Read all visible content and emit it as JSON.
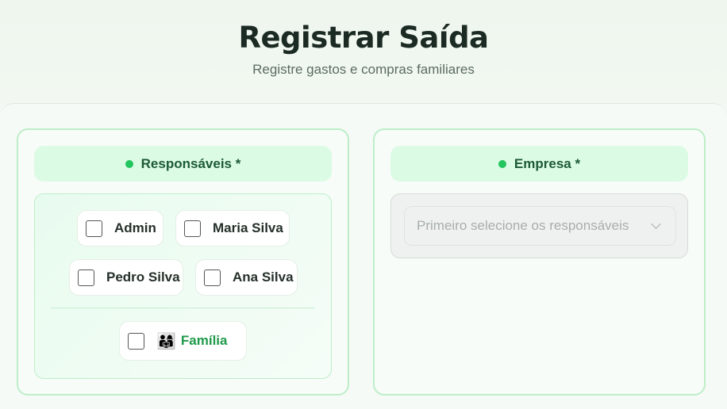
{
  "header": {
    "title": "Registrar Saída",
    "subtitle": "Registre gastos e compras familiares"
  },
  "responsaveis": {
    "label": "Responsáveis *",
    "people": [
      {
        "name": "Admin",
        "checked": false
      },
      {
        "name": "Maria Silva",
        "checked": false
      },
      {
        "name": "Pedro Silva",
        "checked": false
      },
      {
        "name": "Ana Silva",
        "checked": false
      }
    ],
    "family": {
      "emoji": "👨‍👩‍👧",
      "name": "Família",
      "checked": false
    }
  },
  "empresa": {
    "label": "Empresa *",
    "placeholder": "Primeiro selecione os responsáveis"
  },
  "colors": {
    "accent": "#22c55e",
    "accent_text": "#1c5a36",
    "pill_bg": "#dcfbe5",
    "border": "#bdeec9",
    "family_text": "#1f9a4a"
  }
}
